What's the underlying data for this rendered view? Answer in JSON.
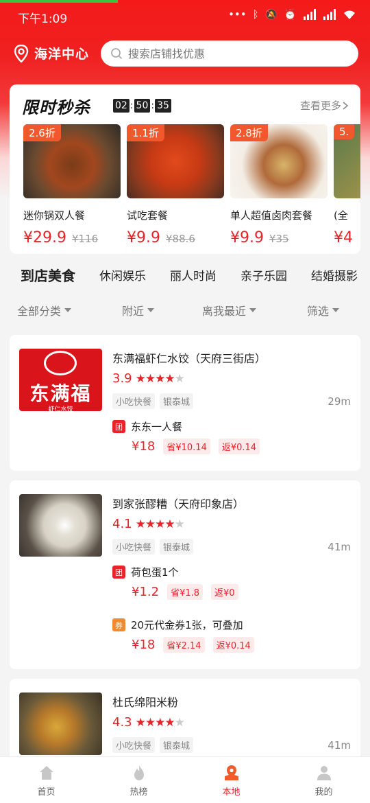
{
  "status": {
    "time": "下午1:09"
  },
  "location": {
    "name": "海洋中心"
  },
  "search": {
    "placeholder": "搜索店铺找优惠"
  },
  "flash_sale": {
    "title": "限时秒杀",
    "timer": {
      "h": "02",
      "m": "50",
      "s": "35"
    },
    "more_label": "查看更多",
    "items": [
      {
        "discount": "2.6折",
        "name": "迷你锅双人餐",
        "price": "¥29.9",
        "original": "¥116"
      },
      {
        "discount": "1.1折",
        "name": "试吃套餐",
        "price": "¥9.9",
        "original": "¥88.6"
      },
      {
        "discount": "2.8折",
        "name": "单人超值卤肉套餐",
        "price": "¥9.9",
        "original": "¥35"
      },
      {
        "discount": "5.",
        "name": "(全",
        "price": "¥4",
        "original": ""
      }
    ]
  },
  "categories": [
    "到店美食",
    "休闲娱乐",
    "丽人时尚",
    "亲子乐园",
    "结婚摄影"
  ],
  "filters": [
    "全部分类",
    "附近",
    "离我最近",
    "筛选"
  ],
  "stores": [
    {
      "name": "东满福虾仁水饺（天府三街店）",
      "rating": "3.9",
      "stars": "★★★★",
      "stars_off": "★",
      "tags": [
        "小吃快餐",
        "银泰城"
      ],
      "distance": "29m",
      "logo_text": "东满福",
      "logo_sub": "虾仁水饺",
      "deals": [
        {
          "badge": "团",
          "name": "东东一人餐",
          "price": "¥18",
          "save": "省¥10.14",
          "back": "返¥0.14"
        }
      ]
    },
    {
      "name": "到家张醪糟（天府印象店）",
      "rating": "4.1",
      "stars": "★★★★",
      "stars_off": "★",
      "tags": [
        "小吃快餐",
        "银泰城"
      ],
      "distance": "41m",
      "deals": [
        {
          "badge": "团",
          "name": "荷包蛋1个",
          "price": "¥1.2",
          "save": "省¥1.8",
          "back": "返¥0"
        },
        {
          "badge": "券",
          "name": "20元代金券1张，可叠加",
          "price": "¥18",
          "save": "省¥2.14",
          "back": "返¥0.14"
        }
      ]
    },
    {
      "name": "杜氏绵阳米粉",
      "rating": "4.3",
      "stars": "★★★★",
      "stars_off": "★",
      "tags": [
        "小吃快餐",
        "银泰城"
      ],
      "distance": "41m",
      "deals": []
    }
  ],
  "tabbar": [
    {
      "label": "首页",
      "icon": "home-icon"
    },
    {
      "label": "热榜",
      "icon": "flame-icon"
    },
    {
      "label": "本地",
      "icon": "map-pin-icon"
    },
    {
      "label": "我的",
      "icon": "user-icon"
    }
  ],
  "colors": {
    "brand_red": "#e8242a",
    "header_red": "#f41a1a",
    "coupon_orange": "#f2892e"
  }
}
